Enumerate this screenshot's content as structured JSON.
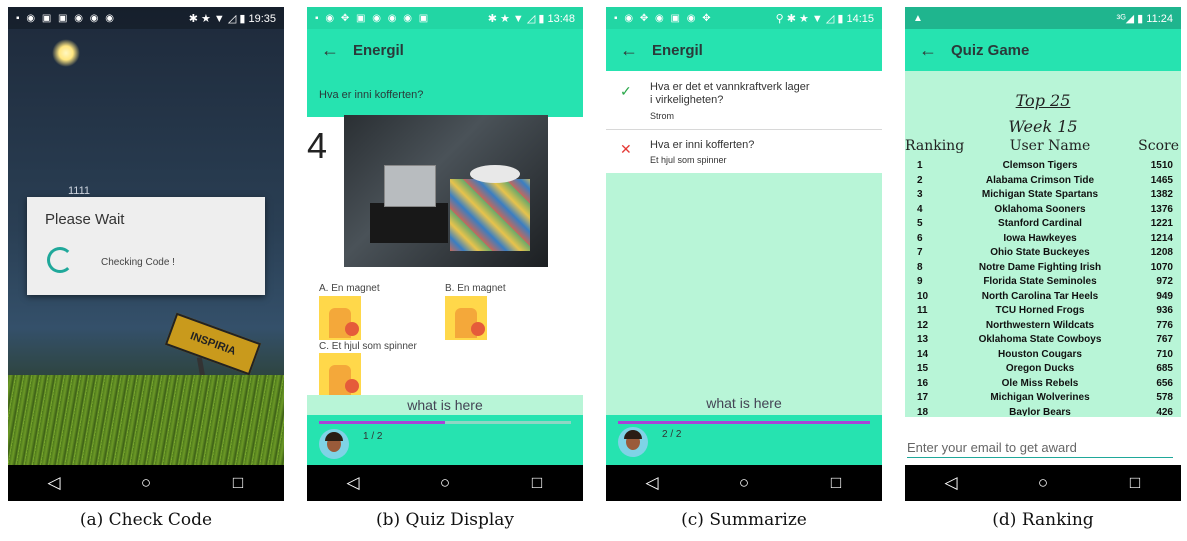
{
  "phones": [
    {
      "status": {
        "left": "▪ ◉ ▣ ▣ ◉ ◉ ◉",
        "right": "✱ ★ ▼ ◿ ▮ 19:35"
      },
      "background_text": "1111",
      "dialog": {
        "title": "Please Wait",
        "message": "Checking Code !"
      },
      "sign_text": "INSPIRIA",
      "caption": "(a) Check Code"
    },
    {
      "status": {
        "left": "▪ ◉ ✥ ▣ ◉ ◉ ◉ ▣",
        "right": "✱ ★ ▼ ◿ ▮ 13:48"
      },
      "app_title": "Energil",
      "question": "Hva er inni kofferten?",
      "question_number": "4",
      "options": [
        {
          "label": "A. En magnet"
        },
        {
          "label": "B. En magnet"
        },
        {
          "label": "C. Et hjul som spinner"
        }
      ],
      "answer_text": "what is here",
      "progress": {
        "label": "1 / 2",
        "fraction": 0.5
      },
      "caption": "(b) Quiz Display"
    },
    {
      "status": {
        "left": "▪ ◉ ✥ ◉ ▣ ◉ ✥",
        "right": "⚲ ✱ ★ ▼ ◿ ▮ 14:15"
      },
      "app_title": "Energil",
      "items": [
        {
          "mark": "✓",
          "mark_color": "#2aa84a",
          "question_line1": "Hva er det et vannkraftverk lager",
          "question_line2": "i virkeligheten?",
          "answer": "Strom"
        },
        {
          "mark": "✕",
          "mark_color": "#e53935",
          "question_line1": "Hva er inni kofferten?",
          "question_line2": "",
          "answer": "Et hjul som spinner"
        }
      ],
      "answer_text": "what is here",
      "progress": {
        "label": "2 / 2",
        "fraction": 1.0
      },
      "caption": "(c) Summarize"
    },
    {
      "status": {
        "left": "▲",
        "right": "³ᴳ◢ ▮ 11:24"
      },
      "app_title": "Quiz Game",
      "heading": "Top 25",
      "subheading": "Week 15",
      "columns": [
        "Ranking",
        "User Name",
        "Score"
      ],
      "rows": [
        {
          "rank": "1",
          "name": "Clemson Tigers",
          "score": "1510"
        },
        {
          "rank": "2",
          "name": "Alabama Crimson Tide",
          "score": "1465"
        },
        {
          "rank": "3",
          "name": "Michigan State Spartans",
          "score": "1382"
        },
        {
          "rank": "4",
          "name": "Oklahoma Sooners",
          "score": "1376"
        },
        {
          "rank": "5",
          "name": "Stanford Cardinal",
          "score": "1221"
        },
        {
          "rank": "6",
          "name": "Iowa Hawkeyes",
          "score": "1214"
        },
        {
          "rank": "7",
          "name": "Ohio State Buckeyes",
          "score": "1208"
        },
        {
          "rank": "8",
          "name": "Notre Dame Fighting Irish",
          "score": "1070"
        },
        {
          "rank": "9",
          "name": "Florida State Seminoles",
          "score": "972"
        },
        {
          "rank": "10",
          "name": "North Carolina Tar Heels",
          "score": "949"
        },
        {
          "rank": "11",
          "name": "TCU Horned Frogs",
          "score": "936"
        },
        {
          "rank": "12",
          "name": "Northwestern Wildcats",
          "score": "776"
        },
        {
          "rank": "13",
          "name": "Oklahoma State Cowboys",
          "score": "767"
        },
        {
          "rank": "14",
          "name": "Houston Cougars",
          "score": "710"
        },
        {
          "rank": "15",
          "name": "Oregon Ducks",
          "score": "685"
        },
        {
          "rank": "16",
          "name": "Ole Miss Rebels",
          "score": "656"
        },
        {
          "rank": "17",
          "name": "Michigan Wolverines",
          "score": "578"
        },
        {
          "rank": "18",
          "name": "Baylor Bears",
          "score": "426"
        }
      ],
      "email_placeholder": "Enter your email to get award",
      "caption": "(d) Ranking"
    }
  ],
  "nav": {
    "back": "◁",
    "home": "○",
    "recents": "□"
  }
}
